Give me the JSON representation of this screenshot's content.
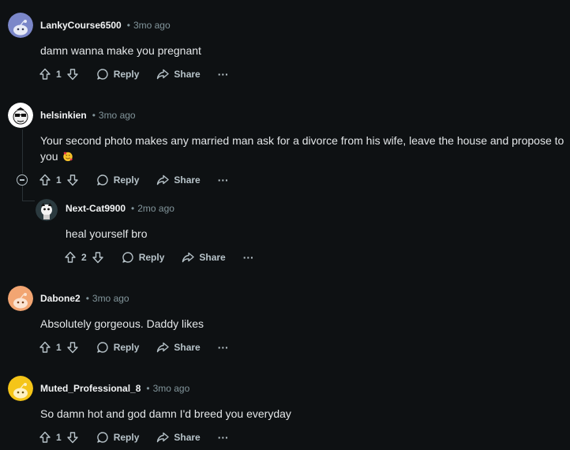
{
  "comments": [
    {
      "author": "LankyCourse6500",
      "separator": "•",
      "time": "3mo ago",
      "text": "damn wanna make you pregnant",
      "votes": "1",
      "reply_label": "Reply",
      "share_label": "Share",
      "more_label": "···",
      "avatar_color": "#7b87c9"
    },
    {
      "author": "helsinkien",
      "separator": "•",
      "time": "3mo ago",
      "text": "Your second photo makes any married man ask for a divorce from his wife, leave the house and propose to you",
      "votes": "1",
      "reply_label": "Reply",
      "share_label": "Share",
      "more_label": "···",
      "avatar_color": "#ffffff"
    },
    {
      "author": "Next-Cat9900",
      "separator": "•",
      "time": "2mo ago",
      "text": "heal yourself bro",
      "votes": "2",
      "reply_label": "Reply",
      "share_label": "Share",
      "more_label": "···",
      "avatar_color": "#2b3a3f"
    },
    {
      "author": "Dabone2",
      "separator": "•",
      "time": "3mo ago",
      "text": "Absolutely gorgeous. Daddy likes",
      "votes": "1",
      "reply_label": "Reply",
      "share_label": "Share",
      "more_label": "···",
      "avatar_color": "#f2a572"
    },
    {
      "author": "Muted_Professional_8",
      "separator": "•",
      "time": "3mo ago",
      "text": "So damn hot and god damn I'd breed you everyday",
      "votes": "1",
      "reply_label": "Reply",
      "share_label": "Share",
      "more_label": "···",
      "avatar_color": "#f5c518"
    }
  ],
  "colors": {
    "background": "#0e1113",
    "text": "#e3e6e8",
    "muted": "#82959b",
    "thread_line": "#2a3236"
  }
}
